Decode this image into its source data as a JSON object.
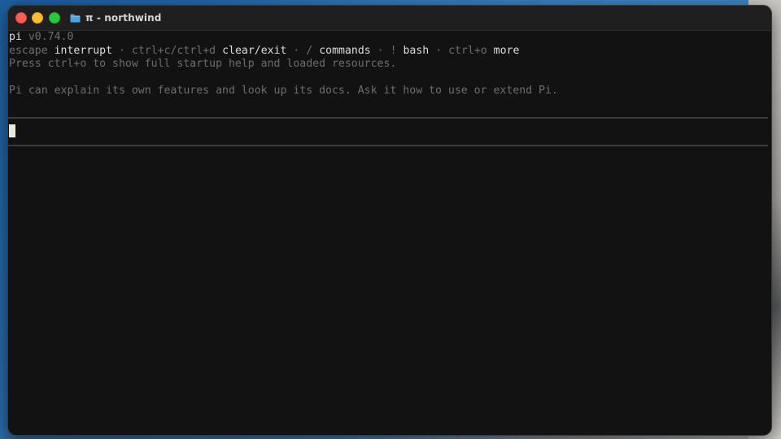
{
  "window": {
    "title": "π - northwind",
    "folder_icon": "folder-icon"
  },
  "terminal": {
    "app_name": "pi",
    "version": "v0.74.0",
    "shortcuts": [
      {
        "key": "escape",
        "action": "interrupt"
      },
      {
        "key": "ctrl+c/ctrl+d",
        "action": "clear/exit"
      },
      {
        "key": "/",
        "action": "commands"
      },
      {
        "key": "!",
        "action": "bash"
      },
      {
        "key": "ctrl+o",
        "action": "more"
      }
    ],
    "separator": " · ",
    "startup_hint": "Press ctrl+o to show full startup help and loaded resources.",
    "info_line": "Pi can explain its own features and look up its docs. Ask it how to use or extend Pi.",
    "input_value": ""
  },
  "colors": {
    "close": "#ff5f57",
    "minimize": "#febc2e",
    "maximize": "#28c840",
    "terminal_bg": "#121212",
    "folder": "#4aa3e8"
  }
}
